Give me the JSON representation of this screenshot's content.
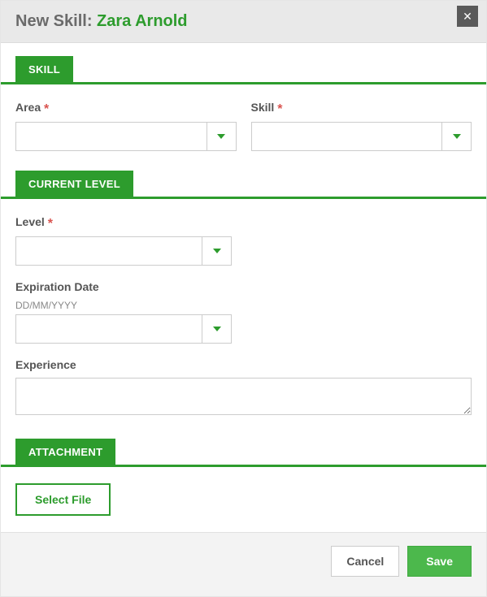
{
  "header": {
    "title_prefix": "New Skill: ",
    "name": "Zara Arnold"
  },
  "sections": {
    "skill": {
      "tab": "SKILL",
      "area_label": "Area",
      "skill_label": "Skill",
      "area_value": "",
      "skill_value": ""
    },
    "current_level": {
      "tab": "CURRENT LEVEL",
      "level_label": "Level",
      "level_value": "",
      "expiration_label": "Expiration Date",
      "expiration_hint": "DD/MM/YYYY",
      "expiration_value": "",
      "experience_label": "Experience",
      "experience_value": ""
    },
    "attachment": {
      "tab": "ATTACHMENT",
      "select_file": "Select File"
    }
  },
  "footer": {
    "cancel": "Cancel",
    "save": "Save"
  },
  "required_marker": "*"
}
